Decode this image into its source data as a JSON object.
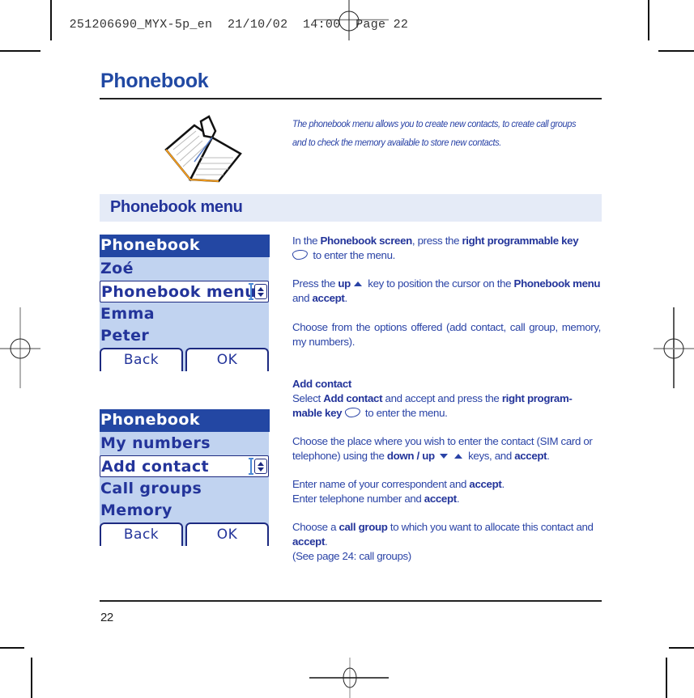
{
  "slug": {
    "file": "251206690_MYX-5p_en",
    "date": "21/10/02",
    "time": "14:00",
    "page_label": "Page 22"
  },
  "page": {
    "title": "Phonebook",
    "intro": "The phonebook menu allows you to create new contacts, to create call groups and to check the memory available to store new contacts.",
    "illustration": "open-book-icon",
    "section_title": "Phonebook menu",
    "page_number": "22"
  },
  "screens": [
    {
      "header": "Phonebook",
      "items": [
        "Zoé",
        "Phonebook menu",
        "Emma",
        "Peter"
      ],
      "selected_index": 1,
      "soft_left": "Back",
      "soft_right": "OK"
    },
    {
      "header": "Phonebook",
      "items": [
        "My numbers",
        "Add contact",
        "Call groups",
        "Memory"
      ],
      "selected_index": 1,
      "soft_left": "Back",
      "soft_right": "OK"
    }
  ],
  "instructions": {
    "p1": {
      "t1": "In the ",
      "b1": "Phonebook screen",
      "t2": ", press the ",
      "b2": "right programmable key",
      "t3": " to enter the menu."
    },
    "p2": {
      "t1": "Press the ",
      "b1": "up",
      "t2": " key to position the cursor on the ",
      "b2": "Phonebook menu",
      "t3": " and ",
      "b3": "accept",
      "t4": "."
    },
    "p3": "Choose from the options offered (add contact, call group, memory, my numbers).",
    "add_contact": {
      "heading": "Add contact",
      "t1": "Select ",
      "b1": "Add contact",
      "t2": " and accept and press the ",
      "b2": "right program-mable key",
      "t3": " to enter the menu."
    },
    "p5": {
      "t1": "Choose the place where you wish to enter the contact (SIM card or telephone) using the ",
      "b1": "down / up",
      "t2": " keys, and ",
      "b2": "accept",
      "t3": "."
    },
    "p6": {
      "t1": "Enter name of your correspondent and ",
      "b1": "accept",
      "t2": ".",
      "t3": "Enter telephone number and ",
      "b2": "accept",
      "t4": "."
    },
    "p7": {
      "t1": "Choose a ",
      "b1": "call group",
      "t2": " to which you want to allocate this contact and ",
      "b2": "accept",
      "t3": ".",
      "t4": "(See page 24: call groups)"
    }
  },
  "colors": {
    "brand_blue": "#2149a3",
    "screen_bg": "#c1d3f0",
    "screen_header": "#2347a3",
    "section_band": "#e5ebf7"
  }
}
